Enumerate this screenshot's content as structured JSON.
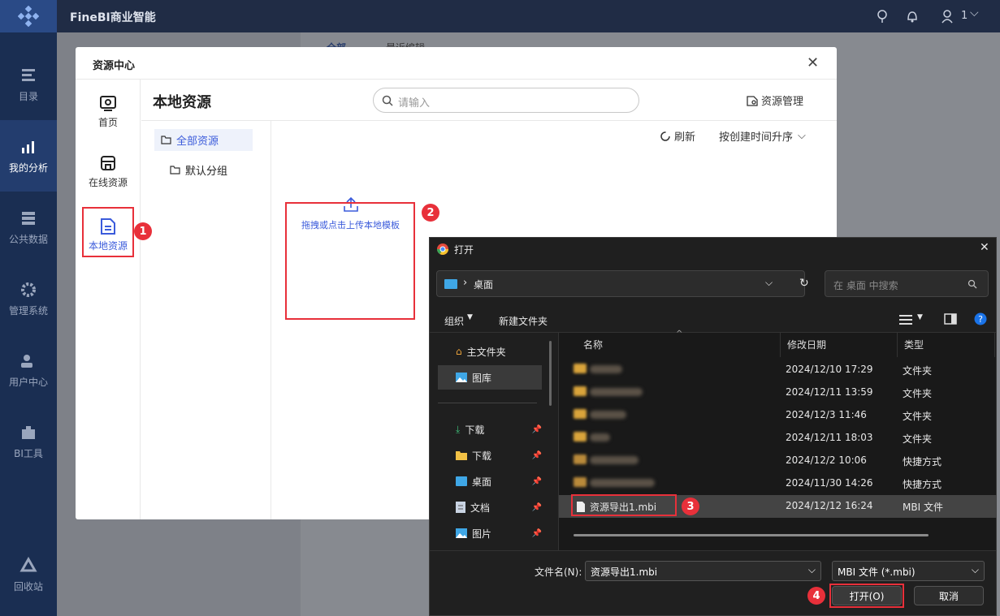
{
  "app": {
    "brand": "FineBI商业智能",
    "user": "1"
  },
  "nav": [
    {
      "label": "目录",
      "icon": "catalog-icon"
    },
    {
      "label": "我的分析",
      "icon": "analysis-icon"
    },
    {
      "label": "公共数据",
      "icon": "data-icon"
    },
    {
      "label": "管理系统",
      "icon": "gear-icon"
    },
    {
      "label": "用户中心",
      "icon": "user-icon"
    },
    {
      "label": "BI工具",
      "icon": "toolbox-icon"
    },
    {
      "label": "回收站",
      "icon": "recycle-icon"
    }
  ],
  "bg": {
    "tab1": "全部",
    "tab2": "最近编辑"
  },
  "resource": {
    "title": "资源中心",
    "heading": "本地资源",
    "search_placeholder": "请输入",
    "manage": "资源管理",
    "refresh": "刷新",
    "sort": "按创建时间升序",
    "side": [
      {
        "label": "首页"
      },
      {
        "label": "在线资源"
      },
      {
        "label": "本地资源"
      }
    ],
    "tree": [
      "全部资源",
      "默认分组"
    ],
    "upload": "拖拽或点击上传本地模板"
  },
  "open_dialog": {
    "title": "打开",
    "path": "桌面",
    "search_placeholder": "在 桌面 中搜索",
    "organize": "组织",
    "new_folder": "新建文件夹",
    "left": [
      {
        "label": "主文件夹"
      },
      {
        "label": "图库"
      },
      {
        "label": "下载"
      },
      {
        "label": "下载"
      },
      {
        "label": "桌面"
      },
      {
        "label": "文档"
      },
      {
        "label": "图片"
      }
    ],
    "columns": [
      "名称",
      "修改日期",
      "类型"
    ],
    "files": [
      {
        "date": "2024/12/10 17:29",
        "type": "文件夹"
      },
      {
        "date": "2024/12/11 13:59",
        "type": "文件夹"
      },
      {
        "date": "2024/12/3 11:46",
        "type": "文件夹"
      },
      {
        "date": "2024/12/11 18:03",
        "type": "文件夹"
      },
      {
        "date": "2024/12/2 10:06",
        "type": "快捷方式"
      },
      {
        "date": "2024/11/30 14:26",
        "type": "快捷方式"
      },
      {
        "name": "资源导出1.mbi",
        "date": "2024/12/12 16:24",
        "type": "MBI 文件"
      }
    ],
    "filename_label": "文件名(N):",
    "filename": "资源导出1.mbi",
    "filter": "MBI 文件 (*.mbi)",
    "open": "打开(O)",
    "cancel": "取消"
  },
  "badges": [
    "1",
    "2",
    "3",
    "4"
  ]
}
